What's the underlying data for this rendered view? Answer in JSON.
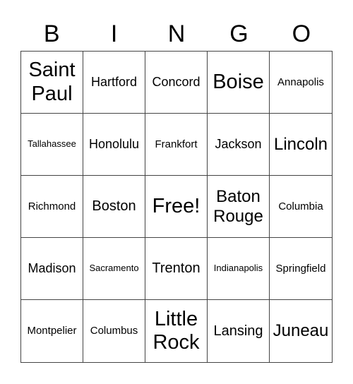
{
  "header": [
    "B",
    "I",
    "N",
    "G",
    "O"
  ],
  "cells": [
    {
      "text": "Saint Paul",
      "size": "s-xl"
    },
    {
      "text": "Hartford",
      "size": "s-sm"
    },
    {
      "text": "Concord",
      "size": "s-sm"
    },
    {
      "text": "Boise",
      "size": "s-xl"
    },
    {
      "text": "Annapolis",
      "size": "s-s"
    },
    {
      "text": "Tallahassee",
      "size": "s-xs"
    },
    {
      "text": "Honolulu",
      "size": "s-sm"
    },
    {
      "text": "Frankfort",
      "size": "s-s"
    },
    {
      "text": "Jackson",
      "size": "s-sm"
    },
    {
      "text": "Lincoln",
      "size": "s-l"
    },
    {
      "text": "Richmond",
      "size": "s-s"
    },
    {
      "text": "Boston",
      "size": "s-m"
    },
    {
      "text": "Free!",
      "size": "s-xl"
    },
    {
      "text": "Baton Rouge",
      "size": "s-l"
    },
    {
      "text": "Columbia",
      "size": "s-s"
    },
    {
      "text": "Madison",
      "size": "s-sm"
    },
    {
      "text": "Sacramento",
      "size": "s-xs"
    },
    {
      "text": "Trenton",
      "size": "s-m"
    },
    {
      "text": "Indianapolis",
      "size": "s-xs"
    },
    {
      "text": "Springfield",
      "size": "s-s"
    },
    {
      "text": "Montpelier",
      "size": "s-s"
    },
    {
      "text": "Columbus",
      "size": "s-s"
    },
    {
      "text": "Little Rock",
      "size": "s-xl"
    },
    {
      "text": "Lansing",
      "size": "s-m"
    },
    {
      "text": "Juneau",
      "size": "s-l"
    }
  ]
}
